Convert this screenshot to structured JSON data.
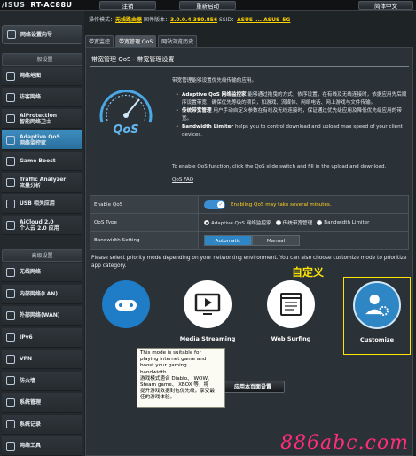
{
  "header": {
    "brand": "/ISUS",
    "model": "RT-AC88U",
    "logout_label": "注销",
    "reboot_label": "重新启动",
    "language_label": "简体中文"
  },
  "firmware_bar": {
    "mode_prefix": "操作模式：",
    "mode_value": "无线路由器",
    "fw_prefix": "固件版本：",
    "fw_value": "3.0.0.4.380.856",
    "ssid_prefix": "SSID：",
    "ssid_value": "ASUS_... ASUS_5G"
  },
  "sidebar": {
    "quick_setup": "网络设置向导",
    "general_header": "一般设置",
    "general_items": [
      {
        "label": "网络地图",
        "active": false
      },
      {
        "label": "访客网络",
        "active": false
      },
      {
        "label": "AiProtection\n智能网络卫士",
        "active": false
      },
      {
        "label": "Adaptive QoS\n网络监控家",
        "active": true
      },
      {
        "label": "Game Boost",
        "active": false
      },
      {
        "label": "Traffic Analyzer\n流量分析",
        "active": false
      },
      {
        "label": "USB 相关应用",
        "active": false
      },
      {
        "label": "AiCloud 2.0\n个人云 2.0 应用",
        "active": false
      }
    ],
    "advanced_header": "高级设置",
    "advanced_items": [
      {
        "label": "无线网络"
      },
      {
        "label": "内部网络(LAN)"
      },
      {
        "label": "外部网络(WAN)"
      },
      {
        "label": "IPv6"
      },
      {
        "label": "VPN"
      },
      {
        "label": "防火墙"
      },
      {
        "label": "系统管理"
      },
      {
        "label": "系统记录"
      },
      {
        "label": "网络工具"
      }
    ]
  },
  "tabs": [
    {
      "label": "带宽监控",
      "active": false
    },
    {
      "label": "带宽管理 QoS",
      "active": true
    },
    {
      "label": "网站浏览历史",
      "active": false
    }
  ],
  "page": {
    "title": "带宽管理 QoS - 带宽管理设置",
    "intro": "带宽管理能够设置优先级传输的应用。",
    "bullets": [
      {
        "head": "Adaptive QoS 网络监控家",
        "text": "能够通过拖曳的方式，依序设置，在有线及无线连接时，依据应用先后顺序设置带宽，确保优先等级的项目，如游戏、流媒体、网络电话、网上游戏与文件传输。"
      },
      {
        "head": "传统带宽管理",
        "text": "用户手动自定义参数在有线及无线连接时，保证通过优先级应用及降低优先级应用的带宽。"
      },
      {
        "head": "Bandwidth Limiter",
        "text": "helps you to control download and upload max speed of your client devices."
      }
    ],
    "enable_hint": "To enable QoS function, click the QoS slide switch and fill in the upload and download.",
    "faq_label": "QoS FAQ",
    "settings": {
      "enable_label": "Enable QoS",
      "enable_note": "Enabling QoS may take several minutes.",
      "type_label": "QoS Type",
      "type_options": [
        "Adaptive QoS 网络监控家",
        "传统带宽管理",
        "Bandwidth Limiter"
      ],
      "type_selected": 0,
      "bw_label": "Bandwidth Setting",
      "bw_auto": "Automatic",
      "bw_manual": "Manual"
    },
    "priority_text": "Please select priority mode depending on your networking environment. You can also choose customize mode to prioritize app category.",
    "custom_annotation": "自定义",
    "modes": [
      {
        "label": "",
        "icon": "gamepad-icon"
      },
      {
        "label": "Media Streaming",
        "icon": "media-streaming-icon"
      },
      {
        "label": "Web Surfing",
        "icon": "web-surfing-icon"
      },
      {
        "label": "Customize",
        "icon": "customize-icon"
      }
    ],
    "apply_label": "应用本页面设置",
    "tooltip": "This mode is suitable for\nplaying internet game and\nboost your gaming\nbandwidth.\n游戏模式適合 Diablo、 WOW、\nSteam game、 XBOX 等，将\n提升游戏数据封包优先级，享受最\n佳的游戏体验。"
  },
  "watermark": "886abc.com",
  "colors": {
    "accent": "#2f86c5",
    "highlight": "#ffe600",
    "warning": "#ffcf24",
    "watermark": "#ff2d7a"
  }
}
